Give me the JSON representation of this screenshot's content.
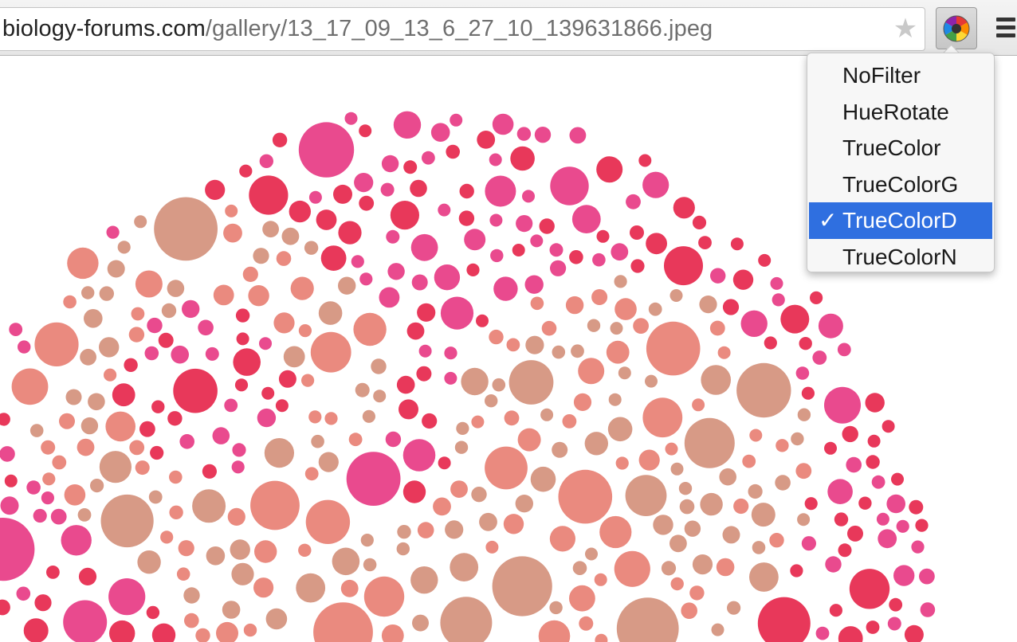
{
  "address_bar": {
    "url_host": "biology-forums.com",
    "url_path": "/gallery/13_17_09_13_6_27_10_139631866.jpeg"
  },
  "toolbar": {
    "bookmark_icon": "star-icon",
    "extension_icon": "color-wheel-icon",
    "menu_icon": "hamburger-menu-icon"
  },
  "filter_menu": {
    "items": [
      {
        "label": "NoFilter",
        "selected": false
      },
      {
        "label": "HueRotate",
        "selected": false
      },
      {
        "label": "TrueColor",
        "selected": false
      },
      {
        "label": "TrueColorG",
        "selected": false
      },
      {
        "label": "TrueColorD",
        "selected": true
      },
      {
        "label": "TrueColorN",
        "selected": false
      }
    ],
    "check_mark": "✓",
    "selected_color": "#2f6fe0"
  },
  "image": {
    "description_icon": "ishihara-plate-image",
    "colors": {
      "red": "#e8385a",
      "pink": "#e94a8e",
      "tan": "#d79a86",
      "salmon": "#ea8a7f",
      "background": "#ffffff"
    }
  }
}
